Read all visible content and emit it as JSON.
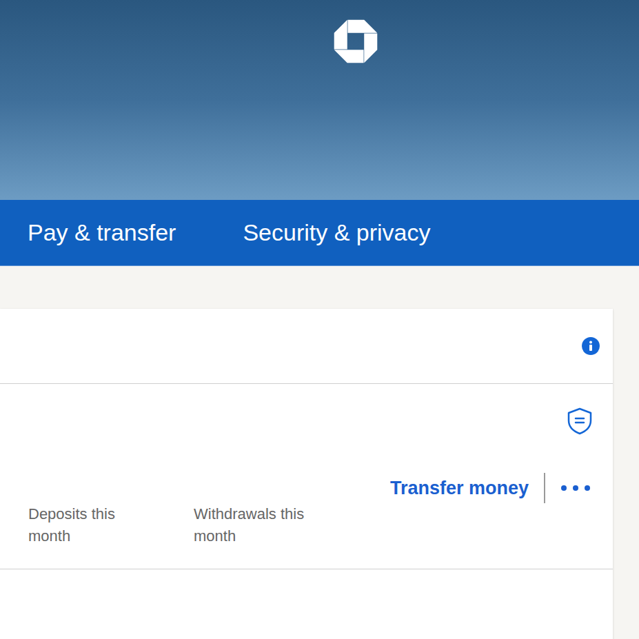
{
  "nav": {
    "items": [
      {
        "label": "Pay & transfer"
      },
      {
        "label": "Security & privacy"
      }
    ]
  },
  "account": {
    "action": "Transfer money",
    "stats": [
      {
        "label": "Deposits this month"
      },
      {
        "label": "Withdrawals this month"
      }
    ]
  }
}
